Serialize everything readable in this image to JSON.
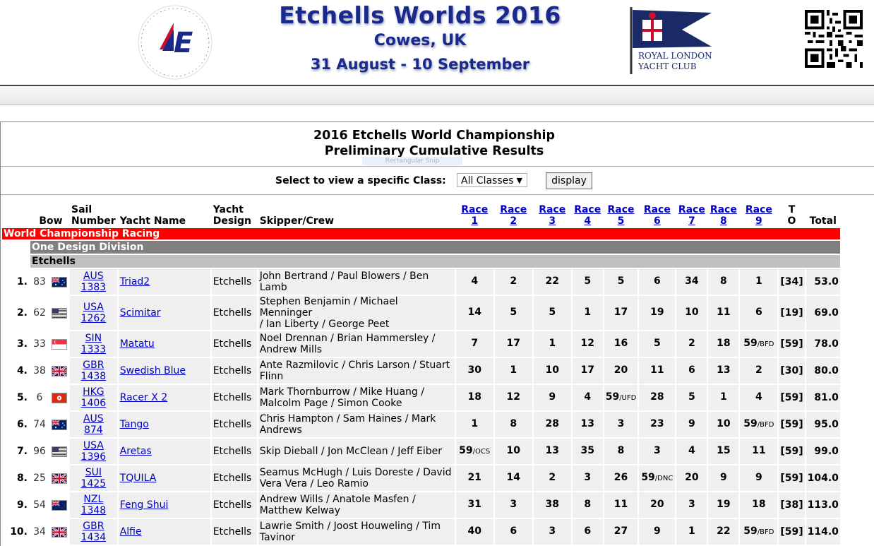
{
  "header": {
    "title": "Etchells Worlds 2016",
    "location": "Cowes, UK",
    "dates": "31 August - 10 September",
    "club_line1": "Royal London",
    "club_line2": "Yacht Club",
    "logo_ring_text": "COWES ETCHELLS"
  },
  "results": {
    "title_line1": "2016 Etchells World Championship",
    "title_line2": "Preliminary Cumulative Results",
    "overlay_text": "Rectangular Snip",
    "select_label": "Select to view a specific Class:",
    "select_value": "All Classes",
    "display_button": "display",
    "columns": {
      "bow": "Bow",
      "sail_1": "Sail",
      "sail_2": "Number",
      "yacht_name": "Yacht Name",
      "design_1": "Yacht",
      "design_2": "Design",
      "skipper": "Skipper/Crew",
      "race_word": "Race",
      "race_nums": [
        "1",
        "2",
        "3",
        "4",
        "5",
        "6",
        "7",
        "8",
        "9"
      ],
      "to_1": "T",
      "to_2": "O",
      "total": "Total"
    },
    "sections": {
      "level1": "World Championship Racing",
      "level2": "One Design Division",
      "level3": "Etchells"
    },
    "rows": [
      {
        "pos": "1.",
        "bow": "83",
        "flag": "AUS",
        "sail_country": "AUS",
        "sail_num": "1383",
        "yacht": "Triad2",
        "design": "Etchells",
        "crew_1": "John Bertrand / Paul Blowers / Ben",
        "crew_2": "Lamb",
        "races": [
          {
            "v": "4",
            "s": ""
          },
          {
            "v": "2",
            "s": ""
          },
          {
            "v": "22",
            "s": ""
          },
          {
            "v": "5",
            "s": ""
          },
          {
            "v": "5",
            "s": ""
          },
          {
            "v": "6",
            "s": ""
          },
          {
            "v": "34",
            "s": ""
          },
          {
            "v": "8",
            "s": ""
          },
          {
            "v": "1",
            "s": ""
          }
        ],
        "to": "[34]",
        "total": "53.0"
      },
      {
        "pos": "2.",
        "bow": "62",
        "flag": "USA",
        "sail_country": "USA",
        "sail_num": "1262",
        "yacht": "Scimitar",
        "design": "Etchells",
        "crew_1": "Stephen Benjamin / Michael Menninger",
        "crew_2": "/ Ian Liberty / George Peet",
        "races": [
          {
            "v": "14",
            "s": ""
          },
          {
            "v": "5",
            "s": ""
          },
          {
            "v": "5",
            "s": ""
          },
          {
            "v": "1",
            "s": ""
          },
          {
            "v": "17",
            "s": ""
          },
          {
            "v": "19",
            "s": ""
          },
          {
            "v": "10",
            "s": ""
          },
          {
            "v": "11",
            "s": ""
          },
          {
            "v": "6",
            "s": ""
          }
        ],
        "to": "[19]",
        "total": "69.0"
      },
      {
        "pos": "3.",
        "bow": "33",
        "flag": "SIN",
        "sail_country": "SIN",
        "sail_num": "1333",
        "yacht": "Matatu",
        "design": "Etchells",
        "crew_1": "Noel Drennan / Brian Hammersley /",
        "crew_2": "Andrew Mills",
        "races": [
          {
            "v": "7",
            "s": ""
          },
          {
            "v": "17",
            "s": ""
          },
          {
            "v": "1",
            "s": ""
          },
          {
            "v": "12",
            "s": ""
          },
          {
            "v": "16",
            "s": ""
          },
          {
            "v": "5",
            "s": ""
          },
          {
            "v": "2",
            "s": ""
          },
          {
            "v": "18",
            "s": ""
          },
          {
            "v": "59",
            "s": "/BFD"
          }
        ],
        "to": "[59]",
        "total": "78.0"
      },
      {
        "pos": "4.",
        "bow": "38",
        "flag": "GBR",
        "sail_country": "GBR",
        "sail_num": "1438",
        "yacht": "Swedish Blue",
        "design": "Etchells",
        "crew_1": "Ante Razmilovic / Chris Larson / Stuart",
        "crew_2": "Flinn",
        "races": [
          {
            "v": "30",
            "s": ""
          },
          {
            "v": "1",
            "s": ""
          },
          {
            "v": "10",
            "s": ""
          },
          {
            "v": "17",
            "s": ""
          },
          {
            "v": "20",
            "s": ""
          },
          {
            "v": "11",
            "s": ""
          },
          {
            "v": "6",
            "s": ""
          },
          {
            "v": "13",
            "s": ""
          },
          {
            "v": "2",
            "s": ""
          }
        ],
        "to": "[30]",
        "total": "80.0"
      },
      {
        "pos": "5.",
        "bow": "6",
        "flag": "HKG",
        "sail_country": "HKG",
        "sail_num": "1406",
        "yacht": "Racer X 2",
        "design": "Etchells",
        "crew_1": "Mark Thornburrow / Mike Huang /",
        "crew_2": "Malcolm Page / Simon Cooke",
        "races": [
          {
            "v": "18",
            "s": ""
          },
          {
            "v": "12",
            "s": ""
          },
          {
            "v": "9",
            "s": ""
          },
          {
            "v": "4",
            "s": ""
          },
          {
            "v": "59",
            "s": "/UFD"
          },
          {
            "v": "28",
            "s": ""
          },
          {
            "v": "5",
            "s": ""
          },
          {
            "v": "1",
            "s": ""
          },
          {
            "v": "4",
            "s": ""
          }
        ],
        "to": "[59]",
        "total": "81.0"
      },
      {
        "pos": "6.",
        "bow": "74",
        "flag": "AUS",
        "sail_country": "AUS",
        "sail_num": "874",
        "yacht": "Tango",
        "design": "Etchells",
        "crew_1": "Chris Hampton / Sam Haines / Mark",
        "crew_2": "Andrews",
        "races": [
          {
            "v": "1",
            "s": ""
          },
          {
            "v": "8",
            "s": ""
          },
          {
            "v": "28",
            "s": ""
          },
          {
            "v": "13",
            "s": ""
          },
          {
            "v": "3",
            "s": ""
          },
          {
            "v": "23",
            "s": ""
          },
          {
            "v": "9",
            "s": ""
          },
          {
            "v": "10",
            "s": ""
          },
          {
            "v": "59",
            "s": "/BFD"
          }
        ],
        "to": "[59]",
        "total": "95.0"
      },
      {
        "pos": "7.",
        "bow": "96",
        "flag": "USA",
        "sail_country": "USA",
        "sail_num": "1396",
        "yacht": "Aretas",
        "design": "Etchells",
        "crew_1": "Skip Dieball / Jon McClean / Jeff Eiber",
        "crew_2": "",
        "races": [
          {
            "v": "59",
            "s": "/OCS"
          },
          {
            "v": "10",
            "s": ""
          },
          {
            "v": "13",
            "s": ""
          },
          {
            "v": "35",
            "s": ""
          },
          {
            "v": "8",
            "s": ""
          },
          {
            "v": "3",
            "s": ""
          },
          {
            "v": "4",
            "s": ""
          },
          {
            "v": "15",
            "s": ""
          },
          {
            "v": "11",
            "s": ""
          }
        ],
        "to": "[59]",
        "total": "99.0"
      },
      {
        "pos": "8.",
        "bow": "25",
        "flag": "GBR",
        "sail_country": "SUI",
        "sail_num": "1425",
        "yacht": "TQUILA",
        "design": "Etchells",
        "crew_1": "Seamus McHugh / Luis Doreste / David",
        "crew_2": "Vera Vera / Leo Ramio",
        "races": [
          {
            "v": "21",
            "s": ""
          },
          {
            "v": "14",
            "s": ""
          },
          {
            "v": "2",
            "s": ""
          },
          {
            "v": "3",
            "s": ""
          },
          {
            "v": "26",
            "s": ""
          },
          {
            "v": "59",
            "s": "/DNC"
          },
          {
            "v": "20",
            "s": ""
          },
          {
            "v": "9",
            "s": ""
          },
          {
            "v": "9",
            "s": ""
          }
        ],
        "to": "[59]",
        "total": "104.0"
      },
      {
        "pos": "9.",
        "bow": "54",
        "flag": "NZL",
        "sail_country": "NZL",
        "sail_num": "1348",
        "yacht": "Feng Shui",
        "design": "Etchells",
        "crew_1": "Andrew Wills / Anatole Masfen /",
        "crew_2": "Matthew Kelway",
        "races": [
          {
            "v": "31",
            "s": ""
          },
          {
            "v": "3",
            "s": ""
          },
          {
            "v": "38",
            "s": ""
          },
          {
            "v": "8",
            "s": ""
          },
          {
            "v": "11",
            "s": ""
          },
          {
            "v": "20",
            "s": ""
          },
          {
            "v": "3",
            "s": ""
          },
          {
            "v": "19",
            "s": ""
          },
          {
            "v": "18",
            "s": ""
          }
        ],
        "to": "[38]",
        "total": "113.0"
      },
      {
        "pos": "10.",
        "bow": "34",
        "flag": "GBR",
        "sail_country": "GBR",
        "sail_num": "1434",
        "yacht": "Alfie",
        "design": "Etchells",
        "crew_1": "Lawrie Smith / Joost Houweling / Tim",
        "crew_2": "Tavinor",
        "races": [
          {
            "v": "40",
            "s": ""
          },
          {
            "v": "6",
            "s": ""
          },
          {
            "v": "3",
            "s": ""
          },
          {
            "v": "6",
            "s": ""
          },
          {
            "v": "27",
            "s": ""
          },
          {
            "v": "9",
            "s": ""
          },
          {
            "v": "1",
            "s": ""
          },
          {
            "v": "22",
            "s": ""
          },
          {
            "v": "59",
            "s": "/BFD"
          }
        ],
        "to": "[59]",
        "total": "114.0"
      }
    ]
  },
  "colors": {
    "banner_blue": "#1a2a8c",
    "link": "#0000cc",
    "section_red": "#ff0000",
    "section_grey": "#808080",
    "section_lightgrey": "#c0c0c0"
  }
}
